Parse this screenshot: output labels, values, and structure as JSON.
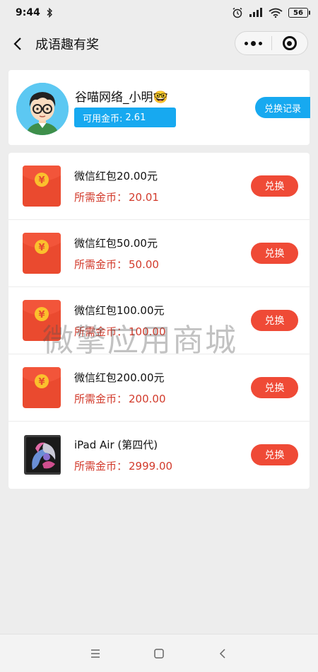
{
  "status_bar": {
    "time": "9:44",
    "battery": "56",
    "icons": [
      "bluetooth-icon",
      "alarm-icon",
      "signal-icon",
      "wifi-icon",
      "battery-icon"
    ]
  },
  "nav": {
    "title": "成语趣有奖"
  },
  "profile": {
    "name": "谷喵网络_小明🤓",
    "coins_label": "可用金币:",
    "coins_value": "2.61",
    "history_label": "兑换记录"
  },
  "rewards": {
    "price_label": "所需金币：",
    "redeem_label": "兑换",
    "items": [
      {
        "title": "微信红包20.00元",
        "price": "20.01",
        "thumb": "red-envelope"
      },
      {
        "title": "微信红包50.00元",
        "price": "50.00",
        "thumb": "red-envelope"
      },
      {
        "title": "微信红包100.00元",
        "price": "100.00",
        "thumb": "red-envelope"
      },
      {
        "title": "微信红包200.00元",
        "price": "200.00",
        "thumb": "red-envelope"
      },
      {
        "title": "iPad Air (第四代)",
        "price": "2999.00",
        "thumb": "ipad"
      }
    ]
  },
  "watermark": "微擎应用商城",
  "colors": {
    "accent_blue": "#17a9f0",
    "redeem_red": "#ef4a36",
    "price_red": "#d23b2c",
    "background": "#ededed"
  }
}
